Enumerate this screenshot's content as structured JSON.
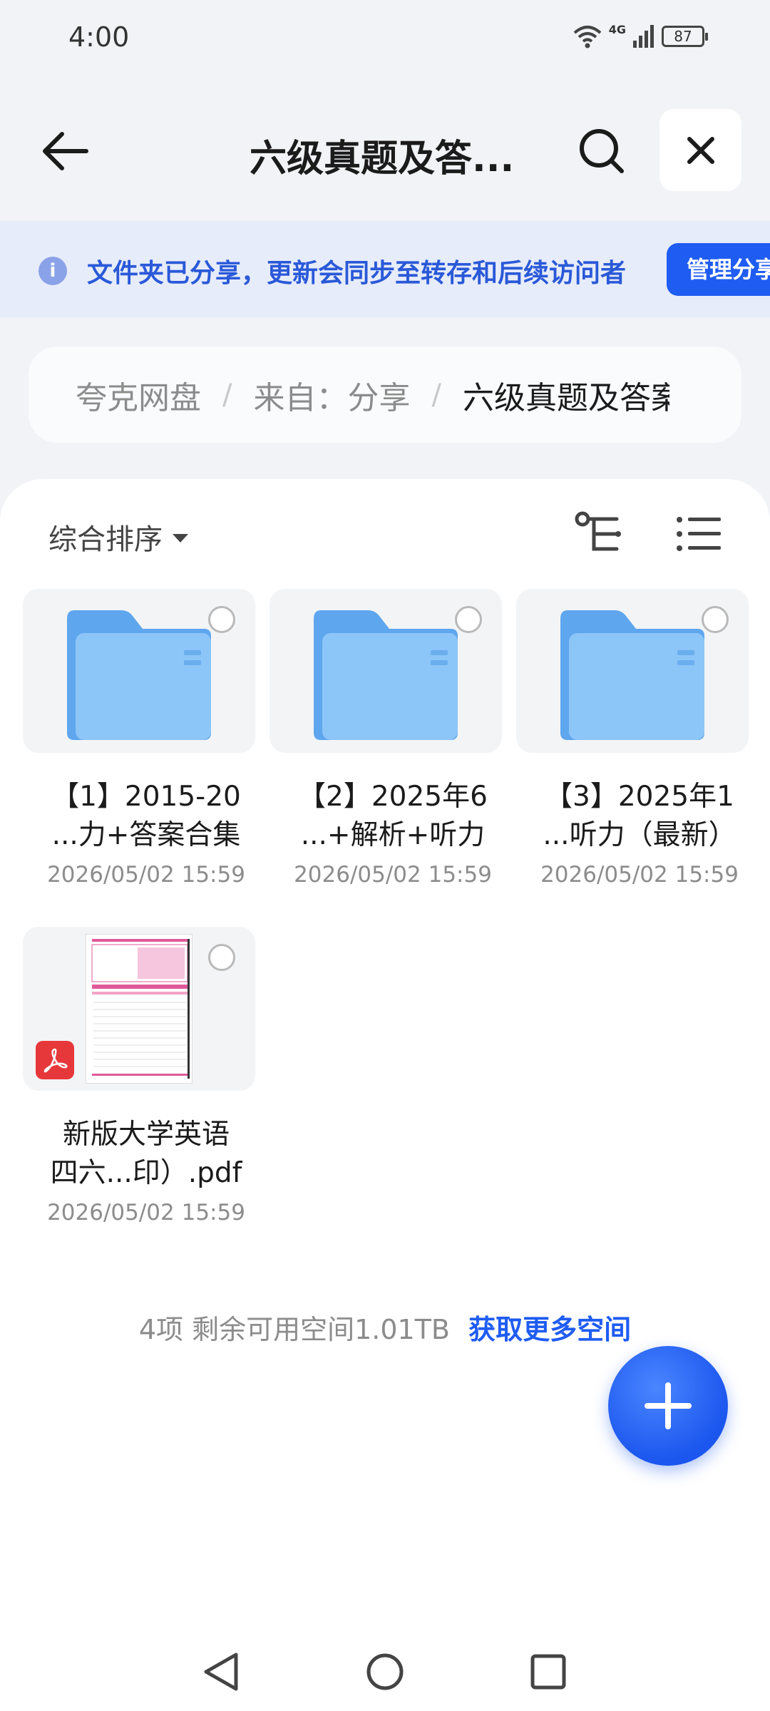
{
  "status_bar": {
    "time": "4:00",
    "network": "4G",
    "battery": "87"
  },
  "header": {
    "title": "六级真题及答..."
  },
  "banner": {
    "text": "文件夹已分享，更新会同步至转存和后续访问者",
    "button": "管理分享"
  },
  "breadcrumb": {
    "items": [
      "夸克网盘",
      "来自：分享",
      "六级真题及答案"
    ]
  },
  "toolbar": {
    "sort_label": "综合排序"
  },
  "files": [
    {
      "name_line1": "【1】2015-20",
      "name_line2": "...力+答案合集",
      "date": "2026/05/02 15:59",
      "type": "folder"
    },
    {
      "name_line1": "【2】2025年6",
      "name_line2": "...+解析+听力",
      "date": "2026/05/02 15:59",
      "type": "folder"
    },
    {
      "name_line1": "【3】2025年1",
      "name_line2": "...听力（最新）",
      "date": "2026/05/02 15:59",
      "type": "folder"
    },
    {
      "name_line1": "新版大学英语",
      "name_line2": "四六...印）.pdf",
      "date": "2026/05/02 15:59",
      "type": "pdf"
    }
  ],
  "footer": {
    "summary": "4项 剩余可用空间1.01TB",
    "link": "获取更多空间"
  },
  "colors": {
    "accent": "#1f5cf2",
    "banner_bg": "#e7ecfa",
    "folder": "#6db3f2"
  }
}
